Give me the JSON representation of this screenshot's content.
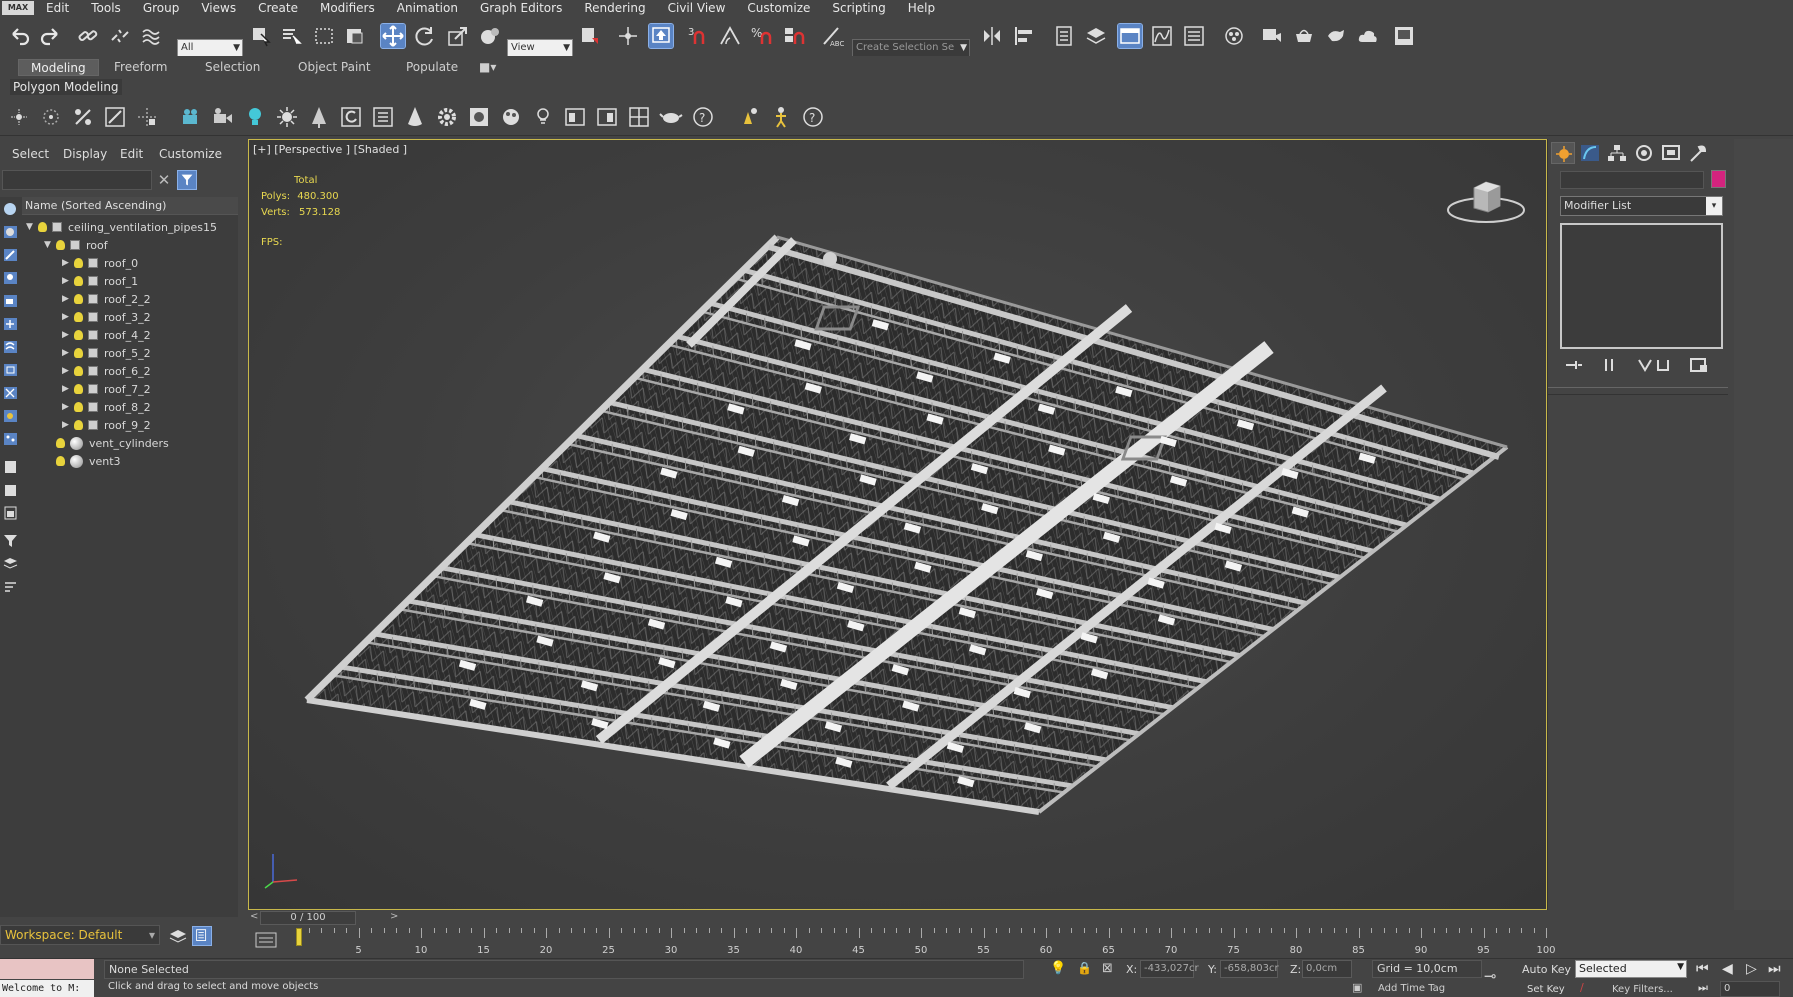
{
  "menu": {
    "logo": "MAX",
    "items": [
      "Edit",
      "Tools",
      "Group",
      "Views",
      "Create",
      "Modifiers",
      "Animation",
      "Graph Editors",
      "Rendering",
      "Civil View",
      "Customize",
      "Scripting",
      "Help"
    ]
  },
  "toolbar": {
    "selection_filter": "All",
    "coord_system": "View",
    "selection_set_placeholder": "Create Selection Se"
  },
  "ribbon": {
    "tabs": [
      "Modeling",
      "Freeform",
      "Selection",
      "Object Paint",
      "Populate"
    ],
    "active_tab": "Modeling",
    "panel_label": "Polygon Modeling"
  },
  "explorer": {
    "tabs": [
      "Select",
      "Display",
      "Edit",
      "Customize"
    ],
    "column_header": "Name (Sorted Ascending)",
    "tree": [
      {
        "name": "ceiling_ventilation_pipes15",
        "kind": "geo",
        "level": 0,
        "expanded": true
      },
      {
        "name": "roof",
        "kind": "geo",
        "level": 1,
        "expanded": true
      },
      {
        "name": "roof_0",
        "kind": "geo",
        "level": 2
      },
      {
        "name": "roof_1",
        "kind": "geo",
        "level": 2
      },
      {
        "name": "roof_2_2",
        "kind": "geo",
        "level": 2
      },
      {
        "name": "roof_3_2",
        "kind": "geo",
        "level": 2
      },
      {
        "name": "roof_4_2",
        "kind": "geo",
        "level": 2
      },
      {
        "name": "roof_5_2",
        "kind": "geo",
        "level": 2
      },
      {
        "name": "roof_6_2",
        "kind": "geo",
        "level": 2
      },
      {
        "name": "roof_7_2",
        "kind": "geo",
        "level": 2
      },
      {
        "name": "roof_8_2",
        "kind": "geo",
        "level": 2
      },
      {
        "name": "roof_9_2",
        "kind": "geo",
        "level": 2
      },
      {
        "name": "vent_cylinders",
        "kind": "sphere",
        "level": 1
      },
      {
        "name": "vent3",
        "kind": "sphere",
        "level": 1
      }
    ],
    "workspace": "Workspace: Default"
  },
  "viewport": {
    "label": "[+] [Perspective ] [Shaded ]",
    "stats": {
      "total_label": "Total",
      "polys_label": "Polys:",
      "polys": "480.300",
      "verts_label": "Verts:",
      "verts": "573.128",
      "fps_label": "FPS:"
    }
  },
  "command_panel": {
    "modifier_list": "Modifier List",
    "object_color": "#d4237e"
  },
  "timeline": {
    "frame_display": "0 / 100",
    "ticks": [
      5,
      10,
      15,
      20,
      25,
      30,
      35,
      40,
      45,
      50,
      55,
      60,
      65,
      70,
      75,
      80,
      85,
      90,
      95,
      100
    ]
  },
  "status": {
    "script_listener": "Welcome to M:",
    "selection": "None Selected",
    "prompt": "Click and drag to select and move objects",
    "x_label": "X:",
    "x": "-433,027cr",
    "y_label": "Y:",
    "y": "-658,803cr",
    "z_label": "Z:",
    "z": "0,0cm",
    "grid": "Grid = 10,0cm",
    "add_time_tag": "Add Time Tag",
    "auto_key": "Auto Key",
    "set_key": "Set Key",
    "key_mode": "Selected",
    "key_filters": "Key Filters...",
    "frame": "0"
  }
}
